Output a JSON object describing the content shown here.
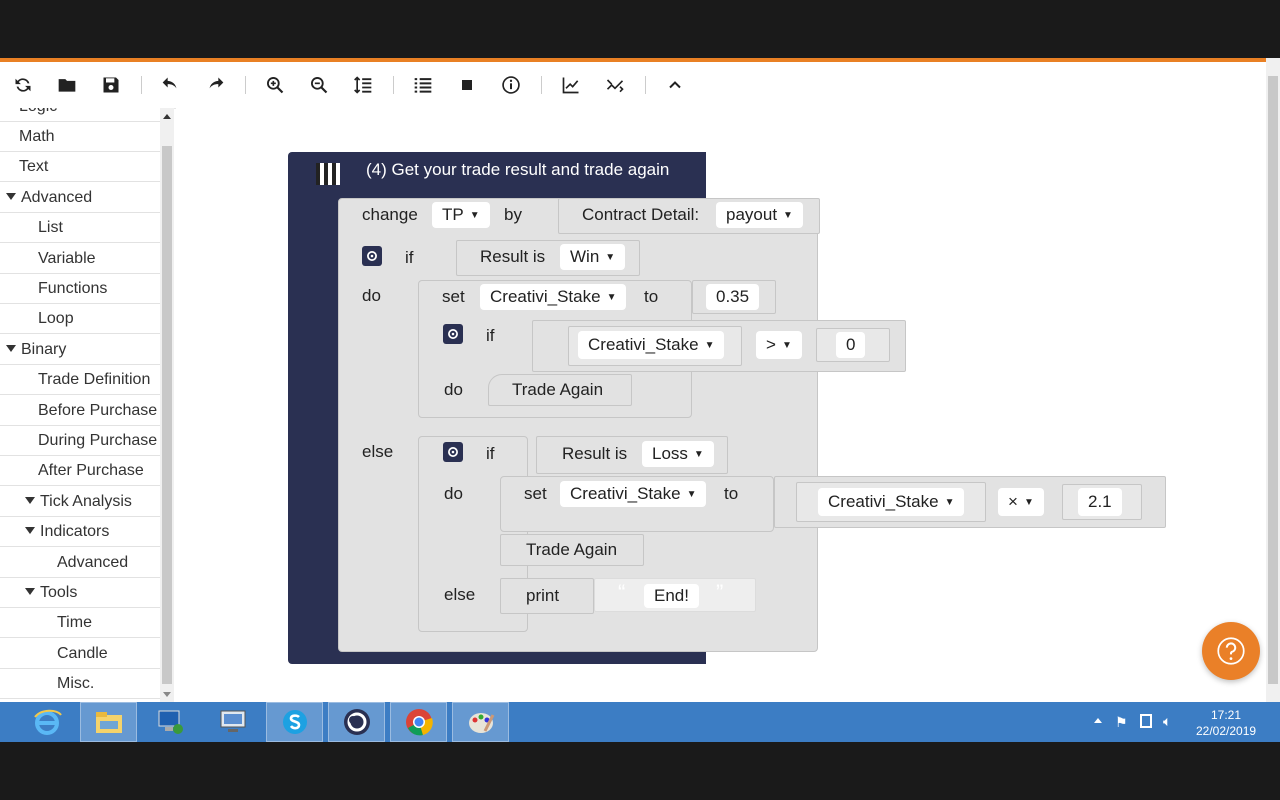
{
  "toolbar": {
    "buttons": [
      "reset-icon",
      "open-icon",
      "save-icon",
      "undo-icon",
      "redo-icon",
      "zoom-in-icon",
      "zoom-out-icon",
      "rearrange-icon",
      "summary-icon",
      "stop-icon",
      "info-icon",
      "chart-icon",
      "trading-view-icon",
      "collapse-icon"
    ]
  },
  "sidebar": {
    "partial": "Logic",
    "items": [
      {
        "label": "Math",
        "level": 0,
        "expand": false
      },
      {
        "label": "Text",
        "level": 0,
        "expand": false
      },
      {
        "label": "Advanced",
        "level": 0,
        "expand": true
      },
      {
        "label": "List",
        "level": 1,
        "expand": false
      },
      {
        "label": "Variable",
        "level": 1,
        "expand": false
      },
      {
        "label": "Functions",
        "level": 1,
        "expand": false
      },
      {
        "label": "Loop",
        "level": 1,
        "expand": false
      },
      {
        "label": "Binary",
        "level": 0,
        "expand": true
      },
      {
        "label": "Trade Definition",
        "level": 1,
        "expand": false
      },
      {
        "label": "Before Purchase",
        "level": 1,
        "expand": false
      },
      {
        "label": "During Purchase",
        "level": 1,
        "expand": false
      },
      {
        "label": "After Purchase",
        "level": 1,
        "expand": false
      },
      {
        "label": "Tick Analysis",
        "level": 1,
        "expand": true
      },
      {
        "label": "Indicators",
        "level": 1,
        "expand": true
      },
      {
        "label": "Advanced",
        "level": 2,
        "expand": false
      },
      {
        "label": "Tools",
        "level": 1,
        "expand": true
      },
      {
        "label": "Time",
        "level": 2,
        "expand": false
      },
      {
        "label": "Candle",
        "level": 2,
        "expand": false
      },
      {
        "label": "Misc.",
        "level": 2,
        "expand": false
      }
    ]
  },
  "workspace": {
    "title": "(4) Get your trade result and trade again",
    "change_label": "change",
    "change_var": "TP",
    "by_label": "by",
    "contract_detail_label": "Contract Detail:",
    "contract_detail_value": "payout",
    "if_label": "if",
    "do_label": "do",
    "else_label": "else",
    "result_is_label": "Result is",
    "win_value": "Win",
    "loss_value": "Loss",
    "set_label": "set",
    "to_label": "to",
    "var_name": "Creativi_Stake",
    "set_value_1": "0.35",
    "compare_op": ">",
    "compare_value": "0",
    "trade_again_label": "Trade Again",
    "multiply_op": "×",
    "multiply_value": "2.1",
    "print_label": "print",
    "print_text": "End!",
    "open_quote": "“",
    "close_quote": "”"
  },
  "colors": {
    "accent": "#e98024",
    "block_dark": "#2a3052",
    "block_light": "#e2e2e2",
    "taskbar": "#3c7dc4"
  },
  "taskbar": {
    "apps": [
      "internet-explorer-icon",
      "file-explorer-icon",
      "network-icon",
      "remote-desktop-icon",
      "skype-icon",
      "app-icon",
      "chrome-icon",
      "paint-icon"
    ],
    "time": "17:21",
    "date": "22/02/2019"
  }
}
